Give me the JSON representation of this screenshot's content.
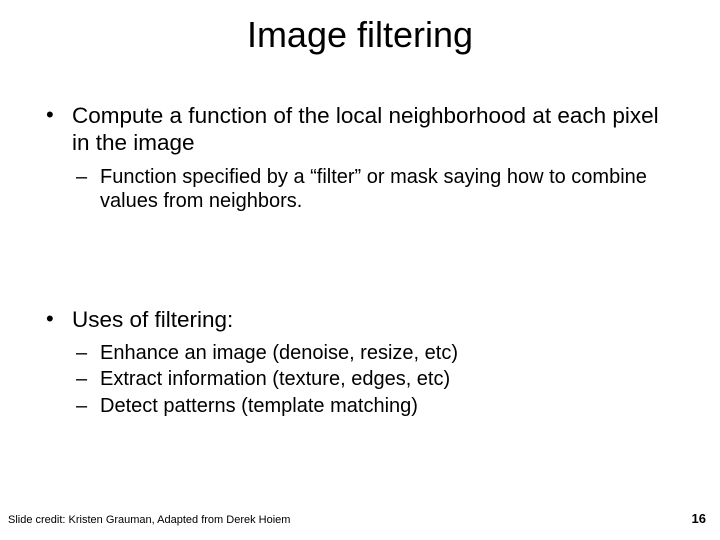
{
  "title": "Image filtering",
  "bullets": {
    "b1": "Compute a function of the local neighborhood at each pixel in the image",
    "b1_sub1": "Function specified by a “filter” or mask saying how to combine values from neighbors.",
    "b2": "Uses of filtering:",
    "b2_sub1": "Enhance an image (denoise, resize, etc)",
    "b2_sub2": "Extract information (texture, edges, etc)",
    "b2_sub3": "Detect patterns (template matching)"
  },
  "footer": {
    "credit": "Slide credit: Kristen Grauman, Adapted from Derek Hoiem",
    "page_number": "16"
  }
}
